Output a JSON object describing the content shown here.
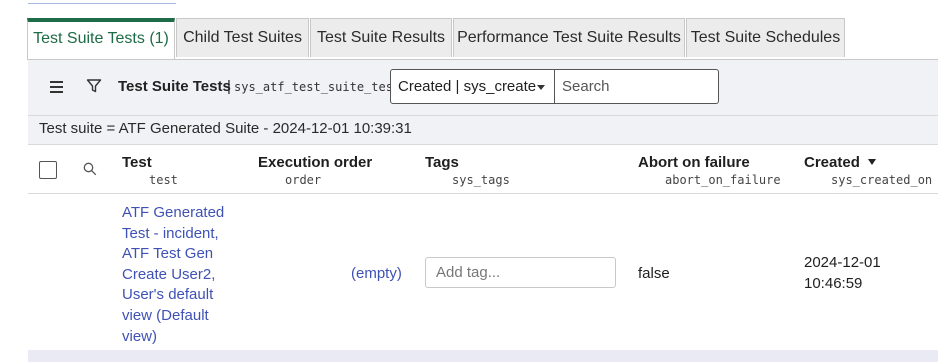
{
  "tabs": [
    {
      "label": "Test Suite Tests (1)",
      "active": true
    },
    {
      "label": "Child Test Suites"
    },
    {
      "label": "Test Suite Results"
    },
    {
      "label": "Performance Test Suite Results"
    },
    {
      "label": "Test Suite Schedules"
    }
  ],
  "toolbar": {
    "title": "Test Suite Tests",
    "separator": "|",
    "table_name": "sys_atf_test_suite_test",
    "search_field_select": "Created | sys_create",
    "search_placeholder": "Search"
  },
  "breadcrumb": "Test suite = ATF Generated Suite - 2024-12-01 10:39:31",
  "columns": [
    {
      "label": "Test",
      "field": "test"
    },
    {
      "label": "Execution order",
      "field": "order"
    },
    {
      "label": "Tags",
      "field": "sys_tags"
    },
    {
      "label": "Abort on failure",
      "field": "abort_on_failure"
    },
    {
      "label": "Created",
      "field": "sys_created_on",
      "sorted": "descending"
    }
  ],
  "rows": [
    {
      "test_lines": [
        "ATF Generated",
        "Test - incident,",
        "ATF Test Gen",
        "Create User2,",
        "User's default",
        "view (Default",
        "view)"
      ],
      "order": "(empty)",
      "tags_placeholder": "Add tag...",
      "abort_on_failure": "false",
      "created_lines": [
        "2024-12-01",
        "10:46:59"
      ]
    }
  ],
  "colors": {
    "accent_green": "#1e6b47",
    "link_blue": "#3f51b5",
    "toolbar_bg": "#f1f2f6"
  },
  "icons": [
    "hamburger-menu-icon",
    "filter-icon",
    "search-icon",
    "sort-descending-icon"
  ]
}
